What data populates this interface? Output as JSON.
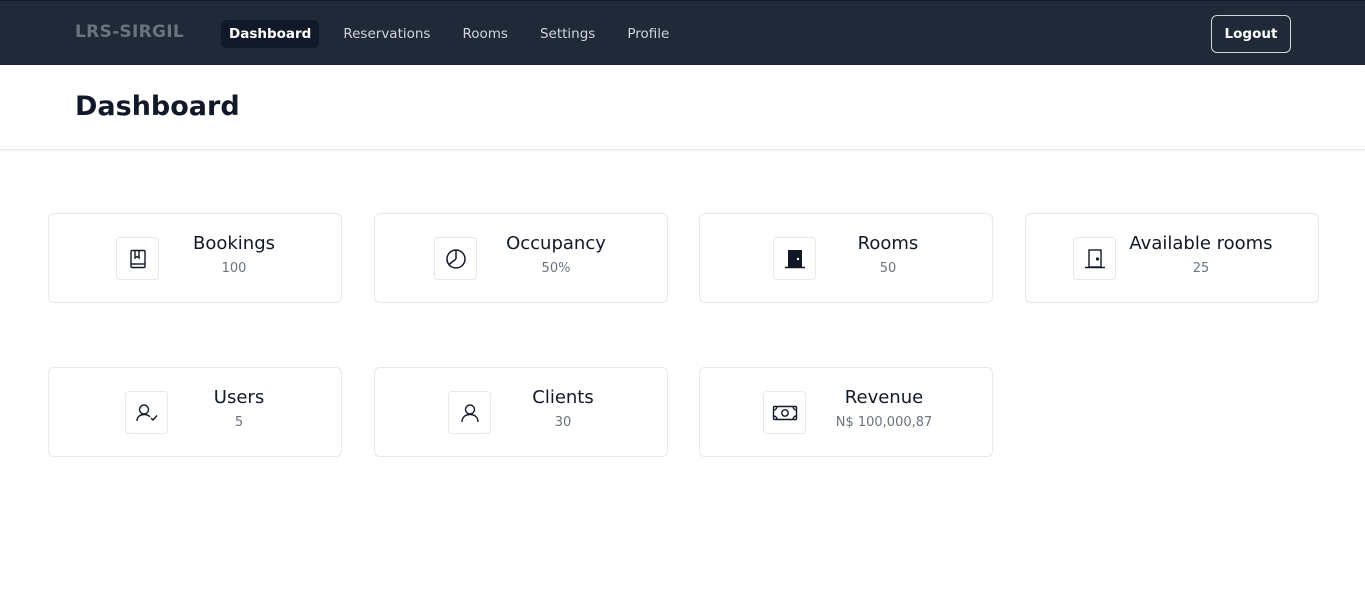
{
  "nav": {
    "brand": "LRS-SIRGIL",
    "links": [
      {
        "label": "Dashboard",
        "active": true
      },
      {
        "label": "Reservations",
        "active": false
      },
      {
        "label": "Rooms",
        "active": false
      },
      {
        "label": "Settings",
        "active": false
      },
      {
        "label": "Profile",
        "active": false
      }
    ],
    "logout_label": "Logout"
  },
  "header": {
    "title": "Dashboard"
  },
  "cards": [
    {
      "title": "Bookings",
      "value": "100",
      "icon": "book-bookmark-icon"
    },
    {
      "title": "Occupancy",
      "value": "50%",
      "icon": "pie-chart-icon"
    },
    {
      "title": "Rooms",
      "value": "50",
      "icon": "door-closed-icon"
    },
    {
      "title": "Available rooms",
      "value": "25",
      "icon": "door-open-icon"
    },
    {
      "title": "Users",
      "value": "5",
      "icon": "user-check-icon"
    },
    {
      "title": "Clients",
      "value": "30",
      "icon": "user-icon"
    },
    {
      "title": "Revenue",
      "value": "N$ 100,000,87",
      "icon": "money-bill-icon"
    }
  ],
  "colors": {
    "navbar_bg": "#1f2937",
    "active_link_bg": "#111827",
    "card_border": "#e5e7eb",
    "muted_text": "#6b7280"
  }
}
